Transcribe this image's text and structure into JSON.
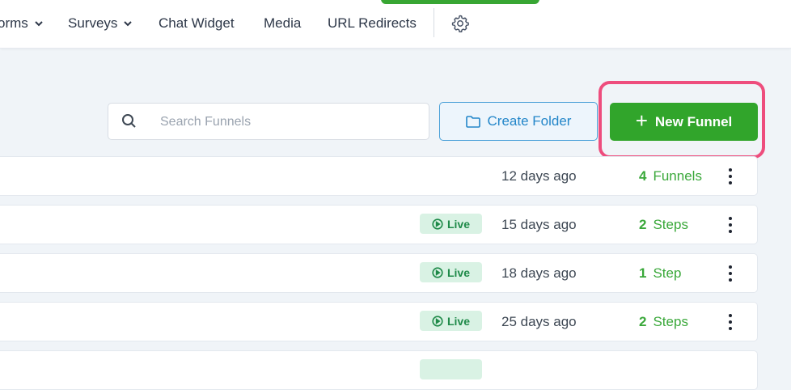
{
  "nav": {
    "items": [
      {
        "label": "orms",
        "has_dropdown": true
      },
      {
        "label": "Surveys",
        "has_dropdown": true
      },
      {
        "label": "Chat Widget",
        "has_dropdown": false
      },
      {
        "label": "Media",
        "has_dropdown": false
      },
      {
        "label": "URL Redirects",
        "has_dropdown": false
      }
    ],
    "settings_icon": "gear-icon"
  },
  "toolbar": {
    "search_placeholder": "Search Funnels",
    "search_value": "",
    "create_folder_label": "Create Folder",
    "new_funnel_label": "New Funnel"
  },
  "colors": {
    "primary_green": "#31a52b",
    "highlight": "#ee4d7d",
    "folder_blue": "#2386c9",
    "live_badge_bg": "#d9f2e4",
    "live_badge_text": "#1f8a49"
  },
  "rows": [
    {
      "status": "",
      "updated": "12 days ago",
      "count": "4",
      "count_label": "Funnels"
    },
    {
      "status": "Live",
      "updated": "15 days ago",
      "count": "2",
      "count_label": "Steps"
    },
    {
      "status": "Live",
      "updated": "18 days ago",
      "count": "1",
      "count_label": "Step"
    },
    {
      "status": "Live",
      "updated": "25 days ago",
      "count": "2",
      "count_label": "Steps"
    }
  ]
}
